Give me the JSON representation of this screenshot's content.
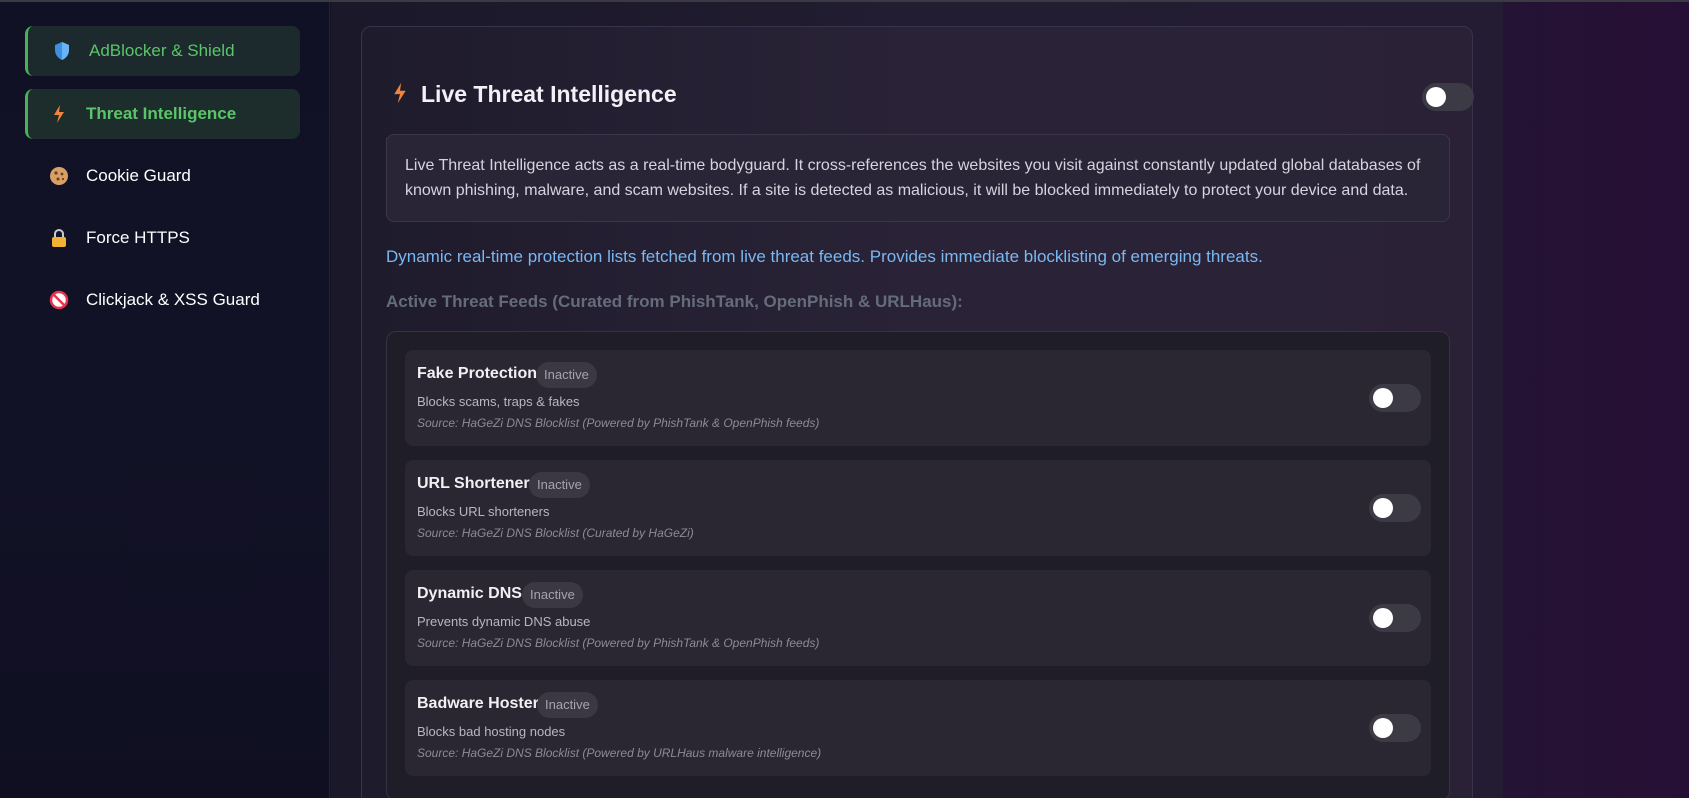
{
  "sidebar": {
    "items": [
      {
        "label": "AdBlocker & Shield",
        "icon": "shield-icon",
        "state": "soft-active"
      },
      {
        "label": "Threat Intelligence",
        "icon": "lightning-icon",
        "state": "active"
      },
      {
        "label": "Cookie Guard",
        "icon": "cookie-icon",
        "state": "normal"
      },
      {
        "label": "Force HTTPS",
        "icon": "lock-icon",
        "state": "normal"
      },
      {
        "label": "Clickjack & XSS Guard",
        "icon": "no-entry-icon",
        "state": "normal"
      }
    ]
  },
  "panel": {
    "title": "Live Threat Intelligence",
    "icon": "lightning-icon",
    "enabled": false,
    "description": "Live Threat Intelligence acts as a real-time bodyguard. It cross-references the websites you visit against constantly updated global databases of known phishing, malware, and scam websites. If a site is detected as malicious, it will be blocked immediately to protect your device and data.",
    "highlight": "Dynamic real-time protection lists fetched from live threat feeds. Provides immediate blocklisting of emerging threats.",
    "feeds_title": "Active Threat Feeds (Curated from PhishTank, OpenPhish & URLHaus):",
    "feeds": [
      {
        "name": "Fake Protection",
        "badge": "Inactive",
        "desc": "Blocks scams, traps & fakes",
        "source": "Source: HaGeZi DNS Blocklist (Powered by PhishTank & OpenPhish feeds)",
        "enabled": false
      },
      {
        "name": "URL Shortener",
        "badge": "Inactive",
        "desc": "Blocks URL shorteners",
        "source": "Source: HaGeZi DNS Blocklist (Curated by HaGeZi)",
        "enabled": false
      },
      {
        "name": "Dynamic DNS",
        "badge": "Inactive",
        "desc": "Prevents dynamic DNS abuse",
        "source": "Source: HaGeZi DNS Blocklist (Powered by PhishTank & OpenPhish feeds)",
        "enabled": false
      },
      {
        "name": "Badware Hoster",
        "badge": "Inactive",
        "desc": "Blocks bad hosting nodes",
        "source": "Source: HaGeZi DNS Blocklist (Powered by URLHaus malware intelligence)",
        "enabled": false
      }
    ]
  },
  "colors": {
    "accent_green": "#5cc46a",
    "link_blue": "#79b8f2",
    "lightning_orange": "#f0843a"
  }
}
